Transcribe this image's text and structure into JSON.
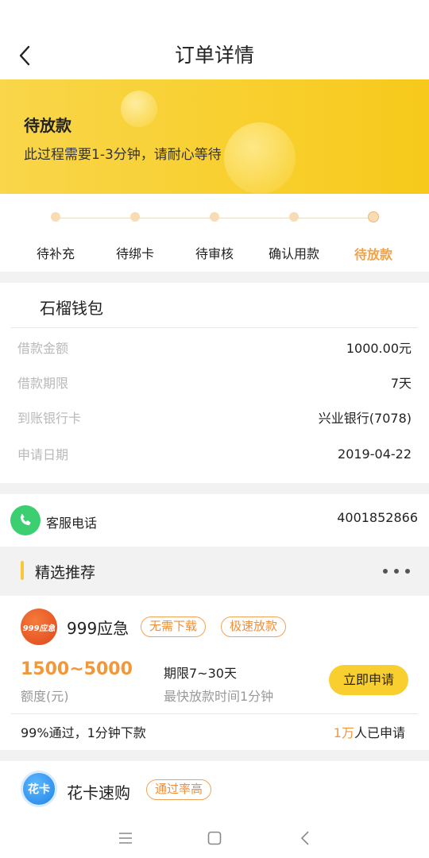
{
  "header": {
    "title": "订单详情"
  },
  "banner": {
    "status_title": "待放款",
    "status_desc": "此过程需要1-3分钟，请耐心等待"
  },
  "steps": [
    {
      "label": "待补充"
    },
    {
      "label": "待绑卡"
    },
    {
      "label": "待审核"
    },
    {
      "label": "确认用款"
    },
    {
      "label": "待放款"
    }
  ],
  "loan": {
    "product_name": "石榴钱包",
    "rows": [
      {
        "key": "借款金额",
        "value": "1000.00元"
      },
      {
        "key": "借款期限",
        "value": "7天"
      },
      {
        "key": "到账银行卡",
        "value": "兴业银行(7078)"
      },
      {
        "key": "申请日期",
        "value": "2019-04-22"
      }
    ]
  },
  "service": {
    "label": "客服电话",
    "number": "4001852866"
  },
  "recommend": {
    "title": "精选推荐",
    "items": [
      {
        "logo_text": "999应急",
        "name": "999应急",
        "tags": [
          "无需下载",
          "极速放款"
        ],
        "amount": "1500~5000",
        "amount_label": "额度(元)",
        "term": "期限7~30天",
        "speed": "最快放款时间1分钟",
        "apply_label": "立即申请",
        "pass_text": "99%通过，1分钟下款",
        "applied_count": "1万",
        "applied_suffix": "人已申请"
      },
      {
        "logo_text": "花卡",
        "name": "花卡速购",
        "tags": [
          "通过率高"
        ]
      }
    ]
  },
  "colors": {
    "accent": "#f8cf2e",
    "highlight": "#f0983a",
    "phone": "#3ccf72"
  }
}
